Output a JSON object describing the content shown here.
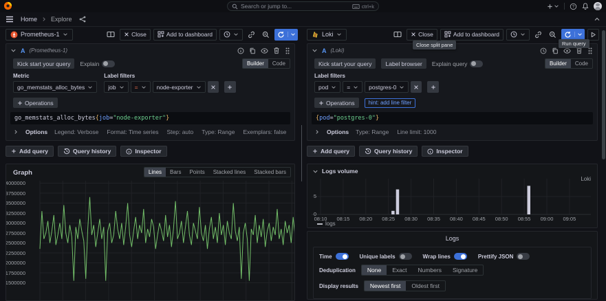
{
  "nav": {
    "search_placeholder": "Search or jump to...",
    "search_shortcut": "ctrl+k",
    "breadcrumb": {
      "home": "Home",
      "current": "Explore"
    },
    "right_icons": [
      "new-menu",
      "help",
      "notifications",
      "profile"
    ]
  },
  "left_pane": {
    "datasource": "Prometheus-1",
    "toolbar": {
      "close": "Close",
      "add_to_dashboard": "Add to dashboard",
      "icons": [
        "split-pane",
        "time-picker",
        "link",
        "zoom-out",
        "run-query",
        "caret"
      ]
    },
    "query": {
      "ref_id": "A",
      "datasource_hint": "(Prometheus-1)",
      "kick_start": "Kick start your query",
      "explain": "Explain",
      "builder": "Builder",
      "code": "Code",
      "metric_label": "Metric",
      "metric_value": "go_memstats_alloc_bytes",
      "filters_label": "Label filters",
      "filter_key": "job",
      "filter_op": "=",
      "filter_value": "node-exporter",
      "operations": "Operations",
      "expr": {
        "metric": "go_memstats_alloc_bytes",
        "open": "{",
        "label": "job",
        "op": "=",
        "value": "\"node-exporter\"",
        "close": "}"
      },
      "options_label": "Options",
      "options_meta": [
        "Legend: Verbose",
        "Format: Time series",
        "Step: auto",
        "Type: Range",
        "Exemplars: false"
      ]
    },
    "footer": {
      "add_query": "Add query",
      "query_history": "Query history",
      "inspector": "Inspector"
    },
    "graph": {
      "title": "Graph",
      "modes": [
        "Lines",
        "Bars",
        "Points",
        "Stacked lines",
        "Stacked bars"
      ],
      "active_mode": "Lines"
    }
  },
  "right_pane": {
    "datasource": "Loki",
    "toolbar": {
      "close": "Close",
      "add_to_dashboard": "Add to dashboard"
    },
    "tooltips": {
      "close_split": "Close split pane",
      "run_query": "Run query"
    },
    "query": {
      "ref_id": "A",
      "datasource_hint": "(Loki)",
      "kick_start": "Kick start your query",
      "label_browser": "Label browser",
      "explain": "Explain query",
      "builder": "Builder",
      "code": "Code",
      "filters_label": "Label filters",
      "filter_key": "pod",
      "filter_op": "=",
      "filter_value": "postgres-0",
      "operations": "Operations",
      "hint": "hint: add line filter",
      "expr": {
        "open": "{",
        "label": "pod",
        "op": "=",
        "value": "\"postgres-0\"",
        "close": "}"
      },
      "options_label": "Options",
      "options_meta": [
        "Type: Range",
        "Line limit: 1000"
      ]
    },
    "footer": {
      "add_query": "Add query",
      "query_history": "Query history",
      "inspector": "Inspector"
    },
    "logs_volume": {
      "title": "Logs volume",
      "source": "Loki",
      "legend": "logs"
    },
    "logs": {
      "title": "Logs",
      "toggles": [
        {
          "label": "Time",
          "on": true
        },
        {
          "label": "Unique labels",
          "on": false
        },
        {
          "label": "Wrap lines",
          "on": true
        },
        {
          "label": "Prettify JSON",
          "on": false
        }
      ],
      "dedup_label": "Deduplication",
      "dedup_options": [
        "None",
        "Exact",
        "Numbers",
        "Signature"
      ],
      "dedup_active": "None",
      "display_label": "Display results",
      "display_options": [
        "Newest first",
        "Oldest first"
      ],
      "display_active": "Newest first"
    }
  },
  "chart_data": [
    {
      "type": "line",
      "title": "Graph",
      "series_name": "go_memstats_alloc_bytes{job=\"node-exporter\"}",
      "color": "#73bf69",
      "ylim": [
        1500000,
        4050000
      ],
      "yticks": [
        4000000,
        3750000,
        3500000,
        3250000,
        3000000,
        2750000,
        2500000,
        2250000,
        2000000,
        1750000,
        1500000
      ],
      "grid": true,
      "values": [
        2350000,
        3300000,
        2600000,
        2750000,
        3050000,
        2500000,
        2800000,
        3200000,
        2450000,
        2700000,
        3000000,
        2600000,
        3450000,
        2750000,
        2500000,
        2950000,
        2650000,
        1550000,
        2900000,
        2600000,
        3100000,
        2800000,
        2550000,
        1600000,
        2850000,
        3650000,
        2700000,
        2950000,
        2400000,
        2750000,
        3100000,
        2600000,
        2900000,
        1550000,
        2800000,
        3000000,
        2500000,
        2700000,
        3300000,
        2850000,
        2600000,
        3000000,
        2450000,
        2900000,
        3500000,
        2700000,
        2400000,
        2800000,
        3150000,
        2600000,
        2950000,
        2750000,
        3350000,
        2500000,
        2850000,
        2650000,
        3100000,
        2900000,
        2350000,
        2700000,
        3000000,
        2800000,
        2550000,
        3200000,
        2650000,
        2950000,
        2400000,
        2850000,
        3550000,
        2600000,
        2750000,
        3050000,
        2500000,
        2900000,
        3300000,
        2700000,
        2450000,
        3000000,
        2800000,
        2600000,
        3400000,
        2750000,
        2550000,
        2950000,
        2350000,
        2850000,
        3150000,
        2600000,
        2900000,
        2500000,
        3250000,
        2700000,
        2950000,
        2450000,
        3050000,
        2750000,
        2600000,
        3500000,
        2800000,
        2550000,
        2900000,
        1600000,
        2750000,
        3000000,
        2600000,
        1550000,
        2850000,
        2700000,
        3200000,
        2500000,
        2950000,
        2650000,
        3100000,
        2400000,
        2800000,
        3000000,
        2550000,
        2900000,
        2700000,
        3350000,
        2600000,
        2850000,
        2450000,
        3050000,
        2750000,
        2950000,
        2500000,
        3150000,
        2650000,
        2900000
      ]
    },
    {
      "type": "bar",
      "title": "Logs volume",
      "source_label": "Loki",
      "legend": [
        "logs"
      ],
      "bar_color": "#ccccdc",
      "ylim": [
        0,
        8
      ],
      "yticks": [
        0,
        5
      ],
      "xticks": [
        "08:10",
        "08:15",
        "08:20",
        "08:25",
        "08:30",
        "08:35",
        "08:40",
        "08:45",
        "08:50",
        "08:55",
        "09:00",
        "09:05"
      ],
      "bars": [
        {
          "time": "08:26",
          "value": 1
        },
        {
          "time": "08:27",
          "value": 7
        },
        {
          "time": "08:56",
          "value": 8
        }
      ]
    }
  ]
}
